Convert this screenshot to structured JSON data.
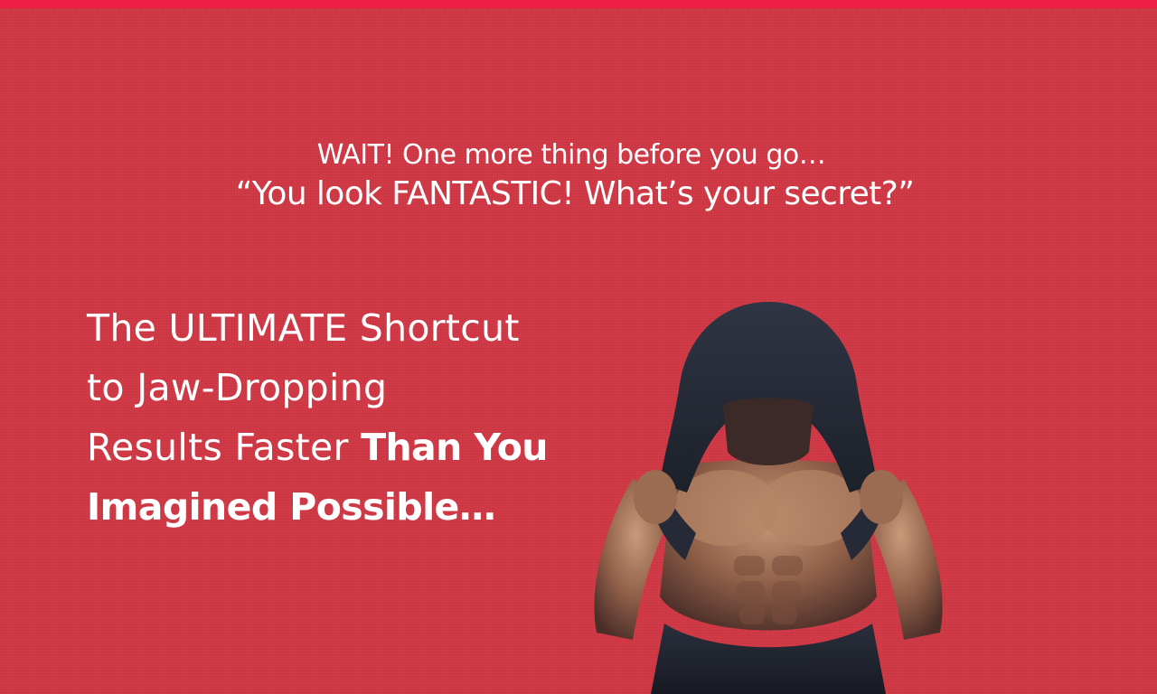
{
  "colors": {
    "background": "#d23a47",
    "accent_bar": "#ee1d45",
    "text": "#ffffff"
  },
  "header": {
    "line1": "WAIT! One more thing before you go…",
    "line2": "“You look FANTASTIC! What’s your secret?”"
  },
  "headline": {
    "line1": "The ULTIMATE Shortcut",
    "line2": "to Jaw-Dropping",
    "line3_regular": "Results Faster ",
    "line3_bold": "Than You",
    "line4": "Imagined Possible…"
  },
  "hero_image": {
    "icon": "hooded-muscular-man-image"
  }
}
